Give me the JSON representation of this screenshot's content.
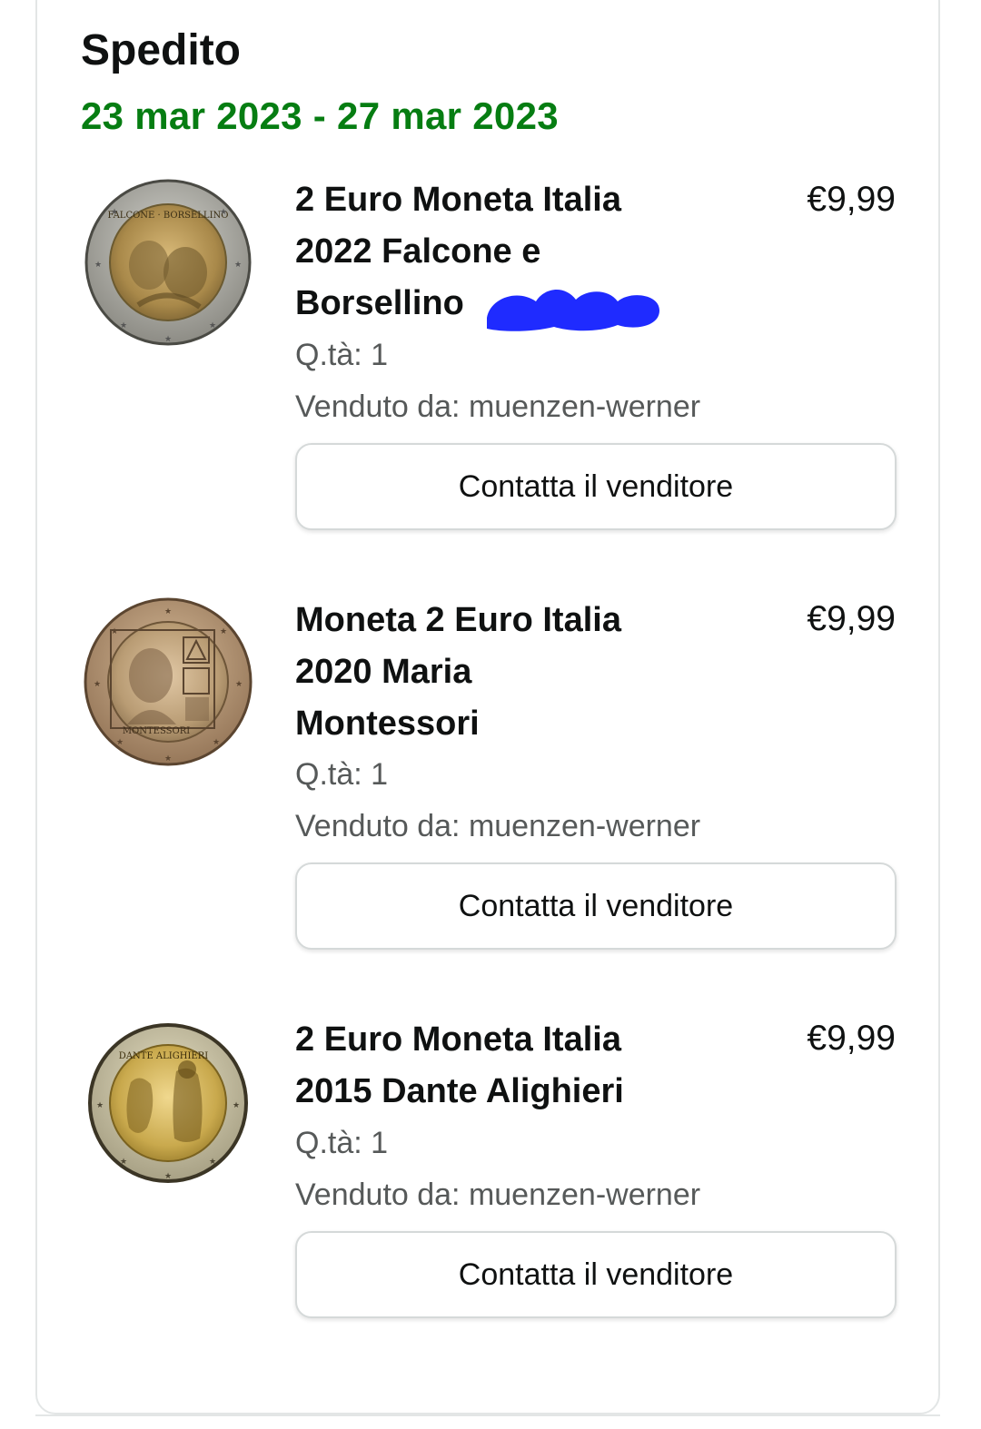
{
  "shipment": {
    "status": "Spedito",
    "dates": "23 mar 2023 - 27 mar 2023",
    "status_color": "#067d12"
  },
  "items": [
    {
      "title_lines": [
        "2 Euro Moneta Italia",
        "2022 Falcone e",
        "Borsellino"
      ],
      "price": "€9,99",
      "qty": "Q.tà: 1",
      "seller": "Venduto da: muenzen-werner",
      "button": "Contatta il venditore",
      "image": "coin-falcone-borsellino"
    },
    {
      "title_lines": [
        "Moneta 2 Euro Italia",
        "2020 Maria",
        "Montessori"
      ],
      "price": "€9,99",
      "qty": "Q.tà: 1",
      "seller": "Venduto da: muenzen-werner",
      "button": "Contatta il venditore",
      "image": "coin-montessori"
    },
    {
      "title_lines": [
        "2 Euro Moneta Italia",
        "2015 Dante Alighieri"
      ],
      "price": "€9,99",
      "qty": "Q.tà: 1",
      "seller": "Venduto da: muenzen-werner",
      "button": "Contatta il venditore",
      "image": "coin-dante-alighieri"
    }
  ],
  "coin_text": {
    "falcone": "FALCONE · BORSELLINO",
    "montessori": "MONTESSORI",
    "dante": "DANTE ALIGHIERI"
  },
  "colors": {
    "redaction": "#1f2bff",
    "border": "#d5d9d9"
  }
}
